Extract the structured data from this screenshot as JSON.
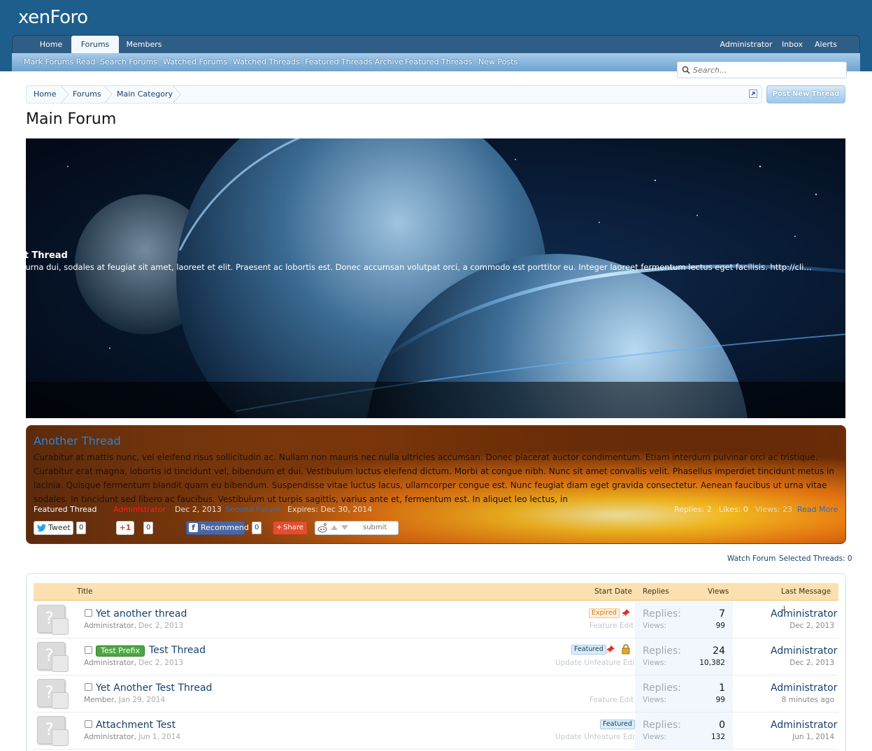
{
  "header": {
    "logo_text": "xenForo"
  },
  "nav": {
    "tabs": [
      {
        "label": "Home"
      },
      {
        "label": "Forums"
      },
      {
        "label": "Members"
      }
    ],
    "user": [
      "Administrator",
      "Inbox",
      "Alerts"
    ]
  },
  "subnav": [
    "Mark Forums Read",
    "Search Forums",
    "Watched Forums",
    "Watched Threads",
    "Featured Threads Archive",
    "Featured Threads",
    "New Posts"
  ],
  "search": {
    "placeholder": "Search..."
  },
  "breadcrumb": [
    "Home",
    "Forums",
    "Main Category"
  ],
  "post_button": "Post New Thread",
  "page_title": "Main Forum",
  "hero": {
    "title": "Test Thread",
    "description": "Sed urna dui, sodales at feugiat sit amet, laoreet et elit. Praesent ac lobortis est. Donec accumsan volutpat orci, a commodo est porttitor eu. Integer laoreet fermentum lectus eget facilisis. http://cliptheapex.com N..."
  },
  "featured": {
    "title": "Another Thread",
    "body": "Curabitur at mattis nunc, vel eleifend risus sollicitudin ac. Nullam non mauris nec nulla ultricies accumsan. Donec placerat auctor condimentum. Etiam interdum pulvinar orci ac tristique. Curabitur erat magna, lobortis id tincidunt vel, bibendum et dui. Vestibulum luctus eleifend dictum. Morbi at congue nibh. Nunc sit amet convallis velit. Phasellus imperdiet tincidunt metus in lacinia. Quisque fermentum blandit quam eu bibendum. Suspendisse vitae luctus lacus, ullamcorper congue est. Nunc feugiat diam eget gravida consectetur. Aenean faucibus ut urna vitae sodales. In tincidunt sed libero ac faucibus. Vestibulum ut turpis sagittis, varius ante et, fermentum est. In aliquet leo lectus, in",
    "label": "Featured Thread",
    "author": "Administrator",
    "date": "Dec 2, 2013",
    "forum": "Second Forum",
    "expires": "Expires: Dec 30, 2014",
    "replies": "Replies: 2",
    "likes": "Likes: 0",
    "views": "Views: 23",
    "read_more": "Read More",
    "share": {
      "tweet": "Tweet",
      "tweet_count": "0",
      "gplus": "+1",
      "gplus_count": "0",
      "recommend": "Recommend",
      "recommend_count": "0",
      "share": "Share",
      "submit": "submit"
    }
  },
  "list_controls": {
    "watch": "Watch Forum",
    "selected": "Selected Threads: 0"
  },
  "columns": [
    "Title",
    "Start Date",
    "Replies",
    "Views",
    "Last Message ↓"
  ],
  "threads": [
    {
      "title": "Yet another thread",
      "prefix": "",
      "author": "Administrator",
      "date": "Dec 2, 2013",
      "tag": "Expired",
      "controls": "Feature Edit",
      "replies_label": "Replies:",
      "replies": "7",
      "views_label": "Views:",
      "views": "99",
      "last_user": "Administrator",
      "last_date": "Dec 2, 2013"
    },
    {
      "title": "Test Thread",
      "prefix": "Test Prefix",
      "author": "Administrator",
      "date": "Dec 2, 2013",
      "tag": "Featured",
      "controls": "Update Unfeature Edit",
      "replies_label": "Replies:",
      "replies": "24",
      "views_label": "Views:",
      "views": "10,382",
      "last_user": "Administrator",
      "last_date": "Dec 2, 2013"
    },
    {
      "title": "Yet Another Test Thread",
      "prefix": "",
      "author": "Member",
      "date": "Jan 29, 2014",
      "tag": "",
      "controls": "Feature Edit",
      "replies_label": "Replies:",
      "replies": "1",
      "views_label": "Views:",
      "views": "99",
      "last_user": "Administrator",
      "last_date": "8 minutes ago"
    },
    {
      "title": "Attachment Test",
      "prefix": "",
      "author": "Administrator",
      "date": "Jun 1, 2014",
      "tag": "Featured",
      "controls": "Update Unfeature Edit",
      "replies_label": "Replies:",
      "replies": "0",
      "views_label": "Views:",
      "views": "132",
      "last_user": "Administrator",
      "last_date": "Jun 1, 2014"
    }
  ],
  "colors": {
    "header": "#1d5e8c",
    "link": "#15416b",
    "list_head": "#fbe0b0",
    "prefix": "#4ca643"
  }
}
